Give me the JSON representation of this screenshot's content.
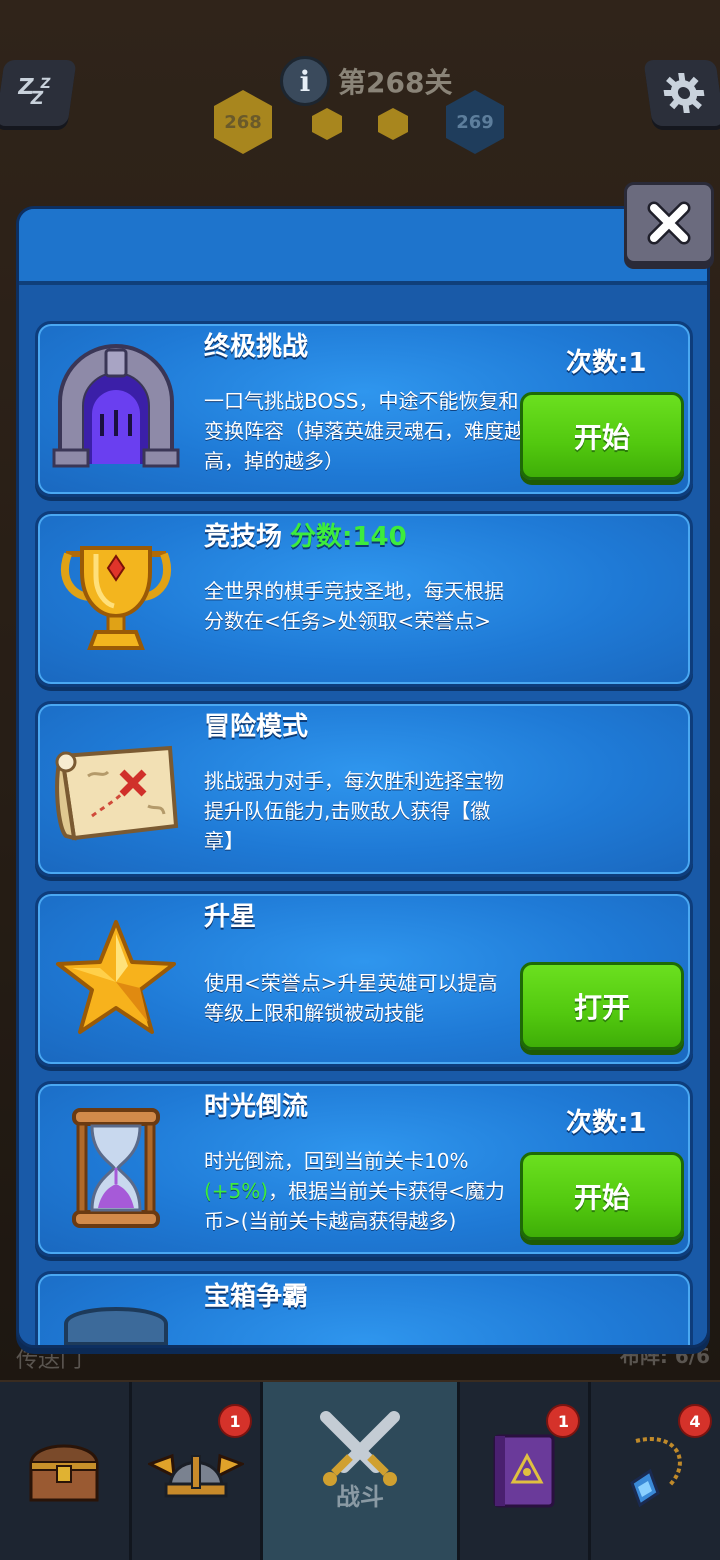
{
  "hud": {
    "level_label": "第268关",
    "current_level": "268",
    "next_level": "269",
    "info_glyph": "i",
    "sleep_icon": "sleep-zzz-icon",
    "settings_icon": "gear-icon"
  },
  "dialog": {
    "close_icon": "close-x-icon",
    "cards": [
      {
        "title": "终极挑战",
        "count": "次数:1",
        "desc": "一口气挑战BOSS，中途不能恢复和变换阵容（掉落英雄灵魂石，难度越高，掉的越多）",
        "button": "开始",
        "icon": "dungeon-gate-icon"
      },
      {
        "title": "竞技场",
        "score": "分数:140",
        "desc": "全世界的棋手竞技圣地，每天根据分数在<任务>处领取<荣誉点>",
        "icon": "trophy-icon"
      },
      {
        "title": "冒险模式",
        "desc": "挑战强力对手，每次胜利选择宝物提升队伍能力,击败敌人获得【徽章】",
        "icon": "treasure-map-icon"
      },
      {
        "title": "升星",
        "desc": "使用<荣誉点>升星英雄可以提高等级上限和解锁被动技能",
        "button": "打开",
        "icon": "star-icon"
      },
      {
        "title": "时光倒流",
        "count": "次数:1",
        "desc_prefix": "时光倒流，回到当前关卡10%",
        "desc_highlight": "(+5%)",
        "desc_suffix": "，根据当前关卡获得<魔力币>(当前关卡越高获得越多)",
        "button": "开始",
        "icon": "hourglass-icon"
      },
      {
        "title": "宝箱争霸",
        "icon": "chest-icon"
      }
    ]
  },
  "background": {
    "portal_label": "传送门",
    "formation_label": "布阵: 6/6"
  },
  "nav": {
    "items": [
      {
        "name": "chest",
        "icon": "treasure-chest-icon",
        "badge": ""
      },
      {
        "name": "heroes",
        "icon": "viking-helmet-icon",
        "badge": "1"
      },
      {
        "name": "battle",
        "icon": "crossed-swords-icon",
        "label": "战斗",
        "badge": ""
      },
      {
        "name": "spellbook",
        "icon": "spellbook-icon",
        "badge": "1"
      },
      {
        "name": "amulet",
        "icon": "amulet-icon",
        "badge": "4"
      }
    ]
  },
  "colors": {
    "panel": "#1a5fb0",
    "card": "#1f7ad6",
    "button_green": "#52c80f",
    "score_green": "#3dec3d",
    "badge_red": "#d5322a"
  }
}
